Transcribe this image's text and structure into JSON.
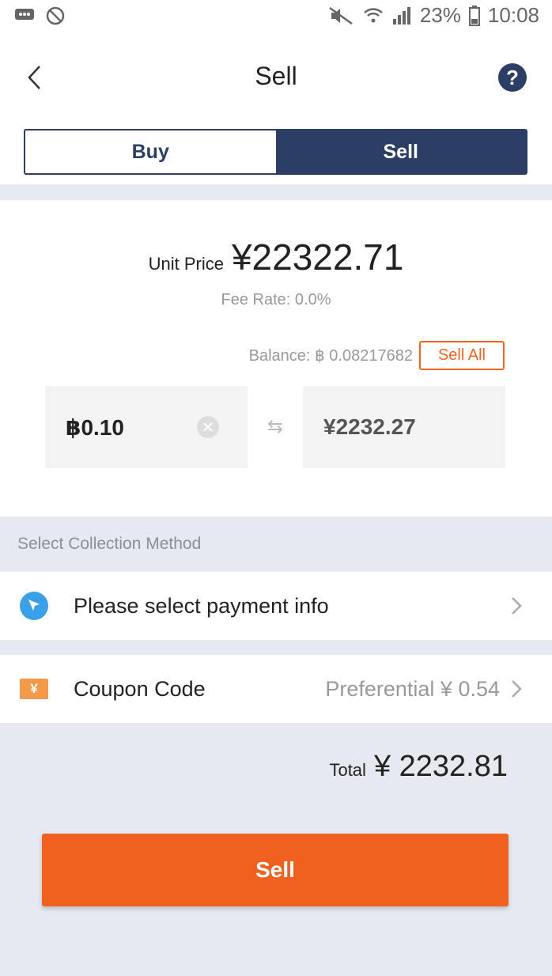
{
  "status_bar": {
    "battery": "23%",
    "time": "10:08"
  },
  "nav": {
    "title": "Sell",
    "help": "?"
  },
  "tabs": {
    "buy": "Buy",
    "sell": "Sell",
    "active": "Sell"
  },
  "price": {
    "unit_label": "Unit Price",
    "unit_value": "¥22322.71",
    "fee_rate": "Fee Rate: 0.0%",
    "balance": "Balance: ฿ 0.08217682",
    "sell_all": "Sell All"
  },
  "amounts": {
    "btc": "฿0.10",
    "cny": "¥2232.27"
  },
  "collection": {
    "section_label": "Select Collection Method",
    "payment_label": "Please select payment info"
  },
  "coupon": {
    "label": "Coupon Code",
    "value": "Preferential ¥ 0.54",
    "icon_text": "¥"
  },
  "total": {
    "label": "Total",
    "value": "¥ 2232.81"
  },
  "action": {
    "sell_button": "Sell"
  },
  "colors": {
    "navy": "#2c3e66",
    "orange": "#f0601f",
    "payment_icon": "#3aa0e8",
    "coupon_icon": "#f2994a"
  }
}
